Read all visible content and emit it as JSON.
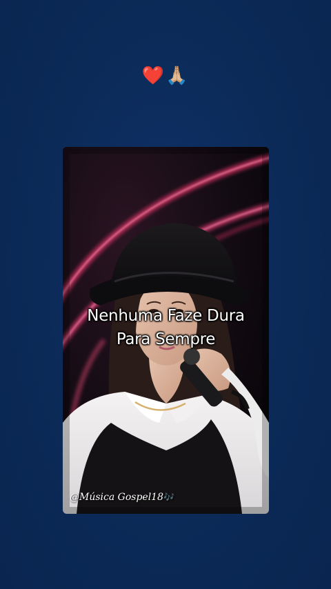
{
  "top_emoji": {
    "heart": "❤️",
    "praying_hands": "🙏🏼"
  },
  "video": {
    "caption_line_1": "Nenhuma Faze Dura",
    "caption_line_2": "Para Sempre",
    "watermark": "@Música Gospel18",
    "watermark_note": "🎶"
  },
  "colors": {
    "background": "#0c2a57",
    "stage_light": "#d63a6a",
    "caption_text": "#ffffff"
  }
}
